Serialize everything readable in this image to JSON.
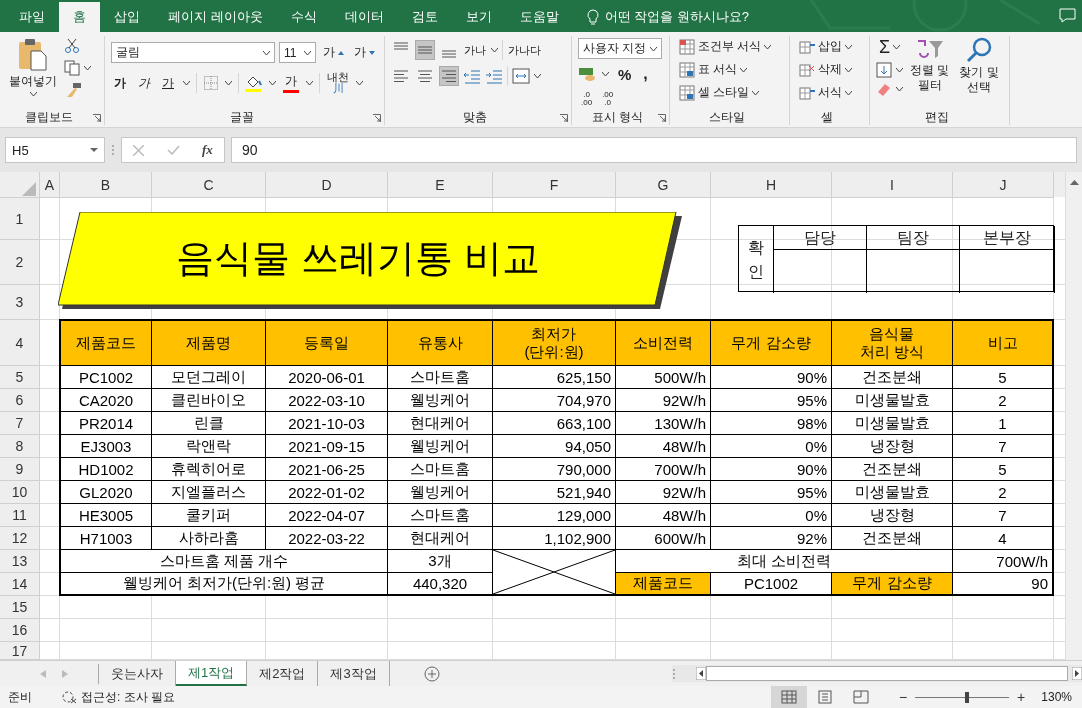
{
  "menu_tabs": [
    {
      "label": "파일",
      "selected": false
    },
    {
      "label": "홈",
      "selected": true
    },
    {
      "label": "삽입",
      "selected": false
    },
    {
      "label": "페이지 레이아웃",
      "selected": false
    },
    {
      "label": "수식",
      "selected": false
    },
    {
      "label": "데이터",
      "selected": false
    },
    {
      "label": "검토",
      "selected": false
    },
    {
      "label": "보기",
      "selected": false
    },
    {
      "label": "도움말",
      "selected": false
    }
  ],
  "tell_me": "어떤 작업을 원하시나요?",
  "ribbon": {
    "clipboard": {
      "paste": "붙여넣기",
      "label": "클립보드"
    },
    "font": {
      "name": "굴림",
      "size": "11",
      "grow": "가",
      "shrink": "가",
      "bold": "가",
      "italic": "가",
      "underline": "가",
      "font_color": "가",
      "phonetic": "내천",
      "phonetic_mark": "川",
      "label": "글꼴"
    },
    "alignment": {
      "vertical": [
        {
          "kind": "top",
          "selected": false
        },
        {
          "kind": "middle",
          "selected": true
        },
        {
          "kind": "bottom",
          "selected": false
        }
      ],
      "horizontal": [
        {
          "kind": "left",
          "selected": false
        },
        {
          "kind": "center",
          "selected": false
        },
        {
          "kind": "right",
          "selected": true
        }
      ],
      "orientation": "가나",
      "wrap": "가나다",
      "label": "맞춤"
    },
    "number": {
      "format": "사용자 지정",
      "percent": "%",
      "comma": ",",
      "decimal_increase": [
        ".0",
        ".00"
      ],
      "decimal_decrease": [
        ".00",
        ".0"
      ],
      "label": "표시 형식"
    },
    "styles": {
      "items": [
        "조건부 서식",
        "표 서식",
        "셀 스타일"
      ],
      "label": "스타일"
    },
    "cells": {
      "items": [
        "삽입",
        "삭제",
        "서식"
      ],
      "label": "셀"
    },
    "editing": {
      "sum": "Σ",
      "sort": "정렬 및\n필터",
      "find": "찾기 및\n선택",
      "label": "편집"
    }
  },
  "formula_bar": {
    "name_box": "H5",
    "fx": "fx",
    "value": "90"
  },
  "sheet": {
    "columns": [
      "A",
      "B",
      "C",
      "D",
      "E",
      "F",
      "G",
      "H",
      "I",
      "J"
    ],
    "rows": [
      "1",
      "2",
      "3",
      "4",
      "5",
      "6",
      "7",
      "8",
      "9",
      "10",
      "11",
      "12",
      "13",
      "14",
      "15",
      "16",
      "17"
    ],
    "title": "음식물 쓰레기통 비교",
    "approval": {
      "label": "확인",
      "roles": [
        "담당",
        "팀장",
        "본부장"
      ]
    },
    "table": {
      "columns": [
        "제품코드",
        "제품명",
        "등록일",
        "유통사",
        "최저가\n(단위:원)",
        "소비전력",
        "무게 감소량",
        "음식물\n처리 방식",
        "비고"
      ],
      "rows": [
        [
          "PC1002",
          "모던그레이",
          "2020-06-01",
          "스마트홈",
          "625,150",
          "500W/h",
          "90%",
          "건조분쇄",
          "5"
        ],
        [
          "CA2020",
          "클린바이오",
          "2022-03-10",
          "웰빙케어",
          "704,970",
          "92W/h",
          "95%",
          "미생물발효",
          "2"
        ],
        [
          "PR2014",
          "린클",
          "2021-10-03",
          "현대케어",
          "663,100",
          "130W/h",
          "98%",
          "미생물발효",
          "1"
        ],
        [
          "EJ3003",
          "락앤락",
          "2021-09-15",
          "웰빙케어",
          "94,050",
          "48W/h",
          "0%",
          "냉장형",
          "7"
        ],
        [
          "HD1002",
          "휴렉히어로",
          "2021-06-25",
          "스마트홈",
          "790,000",
          "700W/h",
          "90%",
          "건조분쇄",
          "5"
        ],
        [
          "GL2020",
          "지엘플러스",
          "2022-01-02",
          "웰빙케어",
          "521,940",
          "92W/h",
          "95%",
          "미생물발효",
          "2"
        ],
        [
          "HE3005",
          "쿨키퍼",
          "2022-04-07",
          "스마트홈",
          "129,000",
          "48W/h",
          "0%",
          "냉장형",
          "7"
        ],
        [
          "H71003",
          "사하라홈",
          "2022-03-22",
          "현대케어",
          "1,102,900",
          "600W/h",
          "92%",
          "건조분쇄",
          "4"
        ]
      ],
      "summary": {
        "count_label": "스마트홈 제품 개수",
        "count_value": "3개",
        "max_label": "최대 소비전력",
        "max_value": "700W/h",
        "avg_label": "웰빙케어 최저가(단위:원) 평균",
        "avg_value": "440,320",
        "code_label": "제품코드",
        "code_value": "PC1002",
        "weight_label": "무게 감소량",
        "weight_value": "90"
      }
    }
  },
  "sheet_tabs": [
    {
      "label": "웃는사자",
      "selected": false
    },
    {
      "label": "제1작업",
      "selected": true
    },
    {
      "label": "제2작업",
      "selected": false
    },
    {
      "label": "제3작업",
      "selected": false
    }
  ],
  "status_bar": {
    "mode": "준비",
    "accessibility": "접근성: 조사 필요",
    "views": [
      {
        "kind": "normal",
        "selected": true
      },
      {
        "kind": "page_layout",
        "selected": false
      },
      {
        "kind": "page_break",
        "selected": false
      }
    ],
    "zoom_out": "−",
    "zoom_in": "+",
    "zoom": {
      "level": 0.55
    },
    "zoom_label": "130%"
  }
}
